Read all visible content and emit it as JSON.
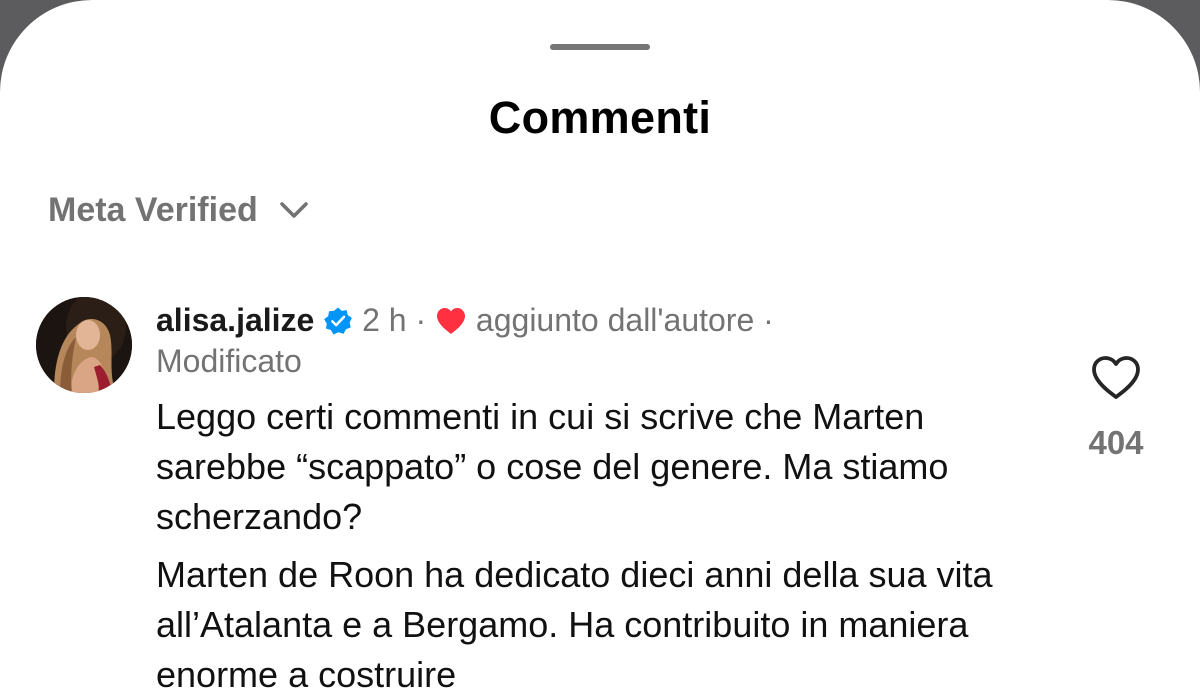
{
  "sheet": {
    "title": "Commenti"
  },
  "filter": {
    "label": "Meta Verified",
    "icon": "chevron-down-icon"
  },
  "comment": {
    "username": "alisa.jalize",
    "verified_icon": "verified-badge-icon",
    "time": "2 h",
    "separator": "·",
    "author_like_icon": "heart-filled-icon",
    "author_like_label": "aggiunto dall'autore",
    "edited_label": "Modificato",
    "paragraphs": [
      "Leggo certi commenti in cui si scrive che Marten sarebbe “scappato” o cose del genere. Ma stiamo scherzando?",
      "Marten de Roon ha dedicato dieci anni della sua vita all’Atalanta e a Bergamo. Ha contribuito in maniera enorme a costruire"
    ],
    "like_count": "404",
    "like_icon": "heart-outline-icon"
  },
  "colors": {
    "backdrop": "#5c5c5e",
    "sheet": "#ffffff",
    "muted_text": "#737373",
    "verified_blue": "#0095f6",
    "heart_red": "#ff3040"
  }
}
